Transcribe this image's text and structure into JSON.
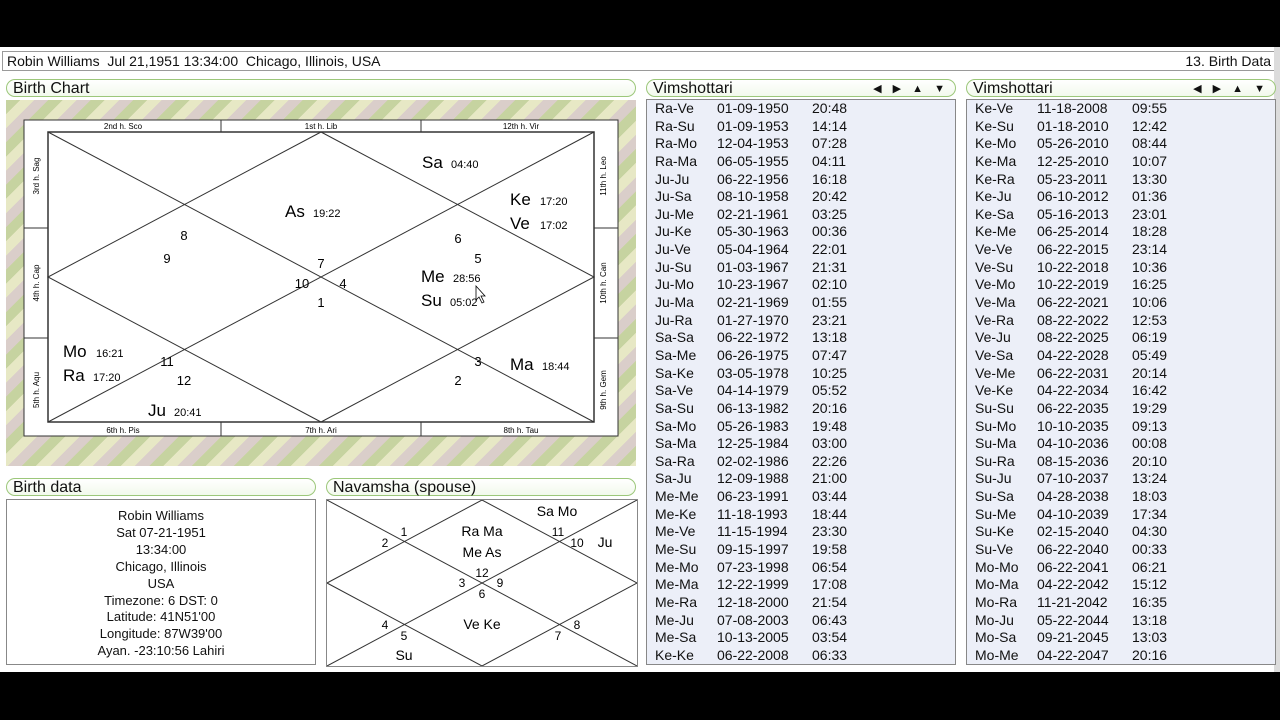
{
  "title_bar": {
    "info": "Robin Williams  Jul 21,1951 13:34:00  Chicago, Illinois, USA",
    "view": "13. Birth Data"
  },
  "birth_chart": {
    "header": "Birth Chart",
    "border_labels": {
      "top": [
        "2nd h.  Sco",
        "1st h.  Lib",
        "12th h.  Vir"
      ],
      "bottom": [
        "6th h.  Pis",
        "7th h.  Ari",
        "8th h.  Tau"
      ],
      "left": [
        "3rd h.  Sag",
        "4th h.  Cap",
        "5th h.  Aqu"
      ],
      "right": [
        "11th h.  Leo",
        "10th h.  Can",
        "9th h.  Gem"
      ]
    },
    "signs": [
      "8",
      "9",
      "7",
      "10",
      "4",
      "1",
      "6",
      "5",
      "11",
      "12",
      "3",
      "2"
    ],
    "planets": [
      {
        "name": "Sa",
        "deg": "04:40"
      },
      {
        "name": "As",
        "deg": "19:22"
      },
      {
        "name": "Ke",
        "deg": "17:20"
      },
      {
        "name": "Ve",
        "deg": "17:02"
      },
      {
        "name": "Me",
        "deg": "28:56"
      },
      {
        "name": "Su",
        "deg": "05:02"
      },
      {
        "name": "Mo",
        "deg": "16:21"
      },
      {
        "name": "Ra",
        "deg": "17:20"
      },
      {
        "name": "Ju",
        "deg": "20:41"
      },
      {
        "name": "Ma",
        "deg": "18:44"
      }
    ]
  },
  "birth_data": {
    "header": "Birth data",
    "lines": [
      "Robin Williams",
      "Sat 07-21-1951",
      "13:34:00",
      "Chicago, Illinois",
      "USA",
      "Timezone: 6 DST: 0",
      "Latitude: 41N51'00",
      "Longitude: 87W39'00",
      "Ayan. -23:10:56 Lahiri"
    ]
  },
  "navamsha": {
    "header": "Navamsha  (spouse)",
    "signs": [
      "1",
      "2",
      "11",
      "10",
      "12",
      "3",
      "9",
      "6",
      "4",
      "5",
      "7",
      "8"
    ],
    "planets": [
      "Sa Mo",
      "Ra Ma",
      "Me As",
      "Ju",
      "Ve Ke",
      "Su"
    ]
  },
  "vimshottari_left": {
    "header": "Vimshottari",
    "nav": "◀ ▶ ▲ ▼",
    "rows": [
      [
        "Ra-Ve",
        "01-09-1950",
        "20:48"
      ],
      [
        "Ra-Su",
        "01-09-1953",
        "14:14"
      ],
      [
        "Ra-Mo",
        "12-04-1953",
        "07:28"
      ],
      [
        "Ra-Ma",
        "06-05-1955",
        "04:11"
      ],
      [
        "Ju-Ju",
        "06-22-1956",
        "16:18"
      ],
      [
        "Ju-Sa",
        "08-10-1958",
        "20:42"
      ],
      [
        "Ju-Me",
        "02-21-1961",
        "03:25"
      ],
      [
        "Ju-Ke",
        "05-30-1963",
        "00:36"
      ],
      [
        "Ju-Ve",
        "05-04-1964",
        "22:01"
      ],
      [
        "Ju-Su",
        "01-03-1967",
        "21:31"
      ],
      [
        "Ju-Mo",
        "10-23-1967",
        "02:10"
      ],
      [
        "Ju-Ma",
        "02-21-1969",
        "01:55"
      ],
      [
        "Ju-Ra",
        "01-27-1970",
        "23:21"
      ],
      [
        "Sa-Sa",
        "06-22-1972",
        "13:18"
      ],
      [
        "Sa-Me",
        "06-26-1975",
        "07:47"
      ],
      [
        "Sa-Ke",
        "03-05-1978",
        "10:25"
      ],
      [
        "Sa-Ve",
        "04-14-1979",
        "05:52"
      ],
      [
        "Sa-Su",
        "06-13-1982",
        "20:16"
      ],
      [
        "Sa-Mo",
        "05-26-1983",
        "19:48"
      ],
      [
        "Sa-Ma",
        "12-25-1984",
        "03:00"
      ],
      [
        "Sa-Ra",
        "02-02-1986",
        "22:26"
      ],
      [
        "Sa-Ju",
        "12-09-1988",
        "21:00"
      ],
      [
        "Me-Me",
        "06-23-1991",
        "03:44"
      ],
      [
        "Me-Ke",
        "11-18-1993",
        "18:44"
      ],
      [
        "Me-Ve",
        "11-15-1994",
        "23:30"
      ],
      [
        "Me-Su",
        "09-15-1997",
        "19:58"
      ],
      [
        "Me-Mo",
        "07-23-1998",
        "06:54"
      ],
      [
        "Me-Ma",
        "12-22-1999",
        "17:08"
      ],
      [
        "Me-Ra",
        "12-18-2000",
        "21:54"
      ],
      [
        "Me-Ju",
        "07-08-2003",
        "06:43"
      ],
      [
        "Me-Sa",
        "10-13-2005",
        "03:54"
      ],
      [
        "Ke-Ke",
        "06-22-2008",
        "06:33"
      ]
    ]
  },
  "vimshottari_right": {
    "header": "Vimshottari",
    "nav": "◀ ▶ ▲ ▼",
    "rows": [
      [
        "Ke-Ve",
        "11-18-2008",
        "09:55"
      ],
      [
        "Ke-Su",
        "01-18-2010",
        "12:42"
      ],
      [
        "Ke-Mo",
        "05-26-2010",
        "08:44"
      ],
      [
        "Ke-Ma",
        "12-25-2010",
        "10:07"
      ],
      [
        "Ke-Ra",
        "05-23-2011",
        "13:30"
      ],
      [
        "Ke-Ju",
        "06-10-2012",
        "01:36"
      ],
      [
        "Ke-Sa",
        "05-16-2013",
        "23:01"
      ],
      [
        "Ke-Me",
        "06-25-2014",
        "18:28"
      ],
      [
        "Ve-Ve",
        "06-22-2015",
        "23:14"
      ],
      [
        "Ve-Su",
        "10-22-2018",
        "10:36"
      ],
      [
        "Ve-Mo",
        "10-22-2019",
        "16:25"
      ],
      [
        "Ve-Ma",
        "06-22-2021",
        "10:06"
      ],
      [
        "Ve-Ra",
        "08-22-2022",
        "12:53"
      ],
      [
        "Ve-Ju",
        "08-22-2025",
        "06:19"
      ],
      [
        "Ve-Sa",
        "04-22-2028",
        "05:49"
      ],
      [
        "Ve-Me",
        "06-22-2031",
        "20:14"
      ],
      [
        "Ve-Ke",
        "04-22-2034",
        "16:42"
      ],
      [
        "Su-Su",
        "06-22-2035",
        "19:29"
      ],
      [
        "Su-Mo",
        "10-10-2035",
        "09:13"
      ],
      [
        "Su-Ma",
        "04-10-2036",
        "00:08"
      ],
      [
        "Su-Ra",
        "08-15-2036",
        "20:10"
      ],
      [
        "Su-Ju",
        "07-10-2037",
        "13:24"
      ],
      [
        "Su-Sa",
        "04-28-2038",
        "18:03"
      ],
      [
        "Su-Me",
        "04-10-2039",
        "17:34"
      ],
      [
        "Su-Ke",
        "02-15-2040",
        "04:30"
      ],
      [
        "Su-Ve",
        "06-22-2040",
        "00:33"
      ],
      [
        "Mo-Mo",
        "06-22-2041",
        "06:21"
      ],
      [
        "Mo-Ma",
        "04-22-2042",
        "15:12"
      ],
      [
        "Mo-Ra",
        "11-21-2042",
        "16:35"
      ],
      [
        "Mo-Ju",
        "05-22-2044",
        "13:18"
      ],
      [
        "Mo-Sa",
        "09-21-2045",
        "13:03"
      ],
      [
        "Mo-Me",
        "04-22-2047",
        "20:16"
      ]
    ]
  }
}
